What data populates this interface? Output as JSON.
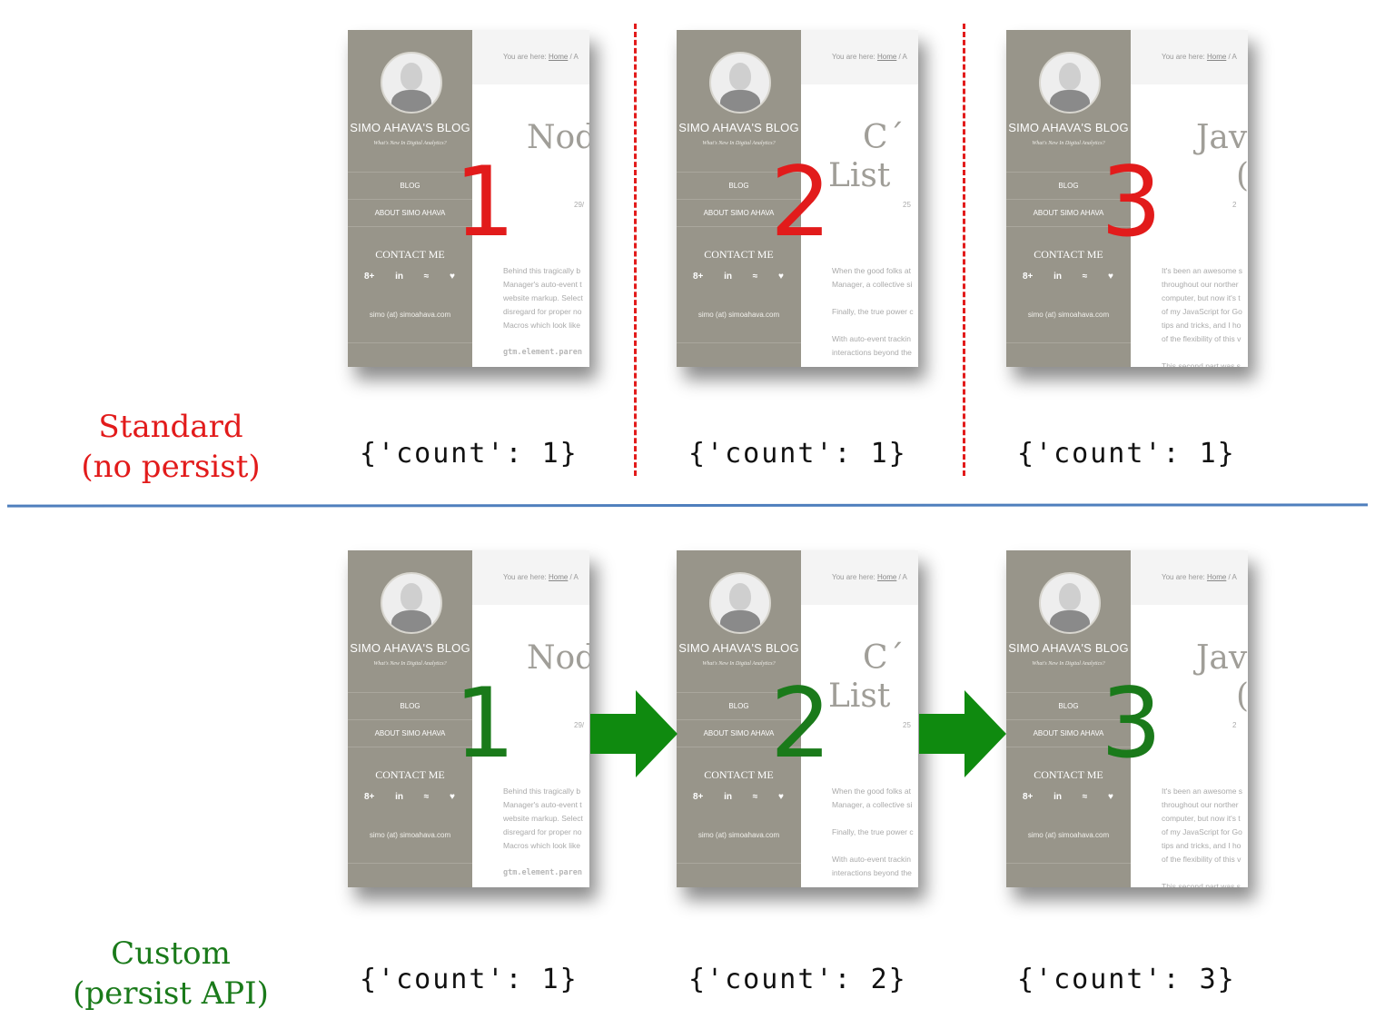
{
  "colors": {
    "standard": "#e21b1b",
    "custom": "#1a7a1a",
    "divider": "#4f7fbd",
    "arrow": "#0f8a0f"
  },
  "rows": [
    {
      "label_line1": "Standard",
      "label_line2": "(no persist)",
      "counts": [
        "{'count': 1}",
        "{'count': 1}",
        "{'count': 1}"
      ]
    },
    {
      "label_line1": "Custom",
      "label_line2": "(persist API)",
      "counts": [
        "{'count': 1}",
        "{'count': 2}",
        "{'count': 3}"
      ]
    }
  ],
  "step_numbers": [
    "1",
    "2",
    "3"
  ],
  "thumbnail": {
    "blog_title": "SIMO AHAVA'S BLOG",
    "tagline": "What's New In Digital Analytics?",
    "nav_blog": "BLOG",
    "nav_about": "ABOUT SIMO AHAVA",
    "contact": "CONTACT ME",
    "socials": [
      "8+",
      "in",
      "≈",
      "♥"
    ],
    "email": "simo (at) simoahava.com",
    "crumb_prefix": "You are here: ",
    "crumb_home": "Home",
    "crumb_sep": " / A"
  },
  "pages": [
    {
      "title": "Nod",
      "date": "29/",
      "excerpt": [
        "Behind this tragically b",
        "Manager's auto-event t",
        "website markup. Select",
        "disregard for proper no",
        "Macros which look like",
        "",
        "gtm.element.paren"
      ]
    },
    {
      "title": "C´\nList",
      "date": "25",
      "excerpt": [
        "When the good folks at",
        "Manager, a collective si",
        "",
        "Finally, the true power c",
        "",
        "With auto-event trackin",
        "interactions beyond the"
      ]
    },
    {
      "title": "Jav\n(",
      "date": "2",
      "excerpt": [
        "It's been an awesome s",
        "throughout our norther",
        "computer, but now it's t",
        "of my JavaScript for Go",
        "tips and tricks, and I ho",
        "of the flexibility of this v",
        "",
        "This second part was s"
      ]
    }
  ]
}
